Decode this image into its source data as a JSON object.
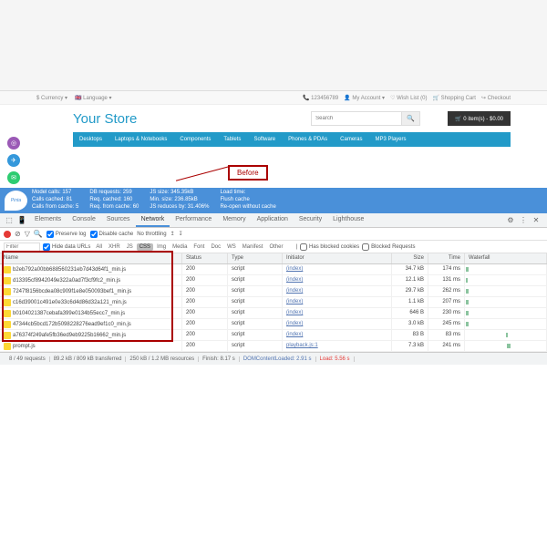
{
  "topbar": {
    "currency": "$ Currency ▾",
    "language": "🇬🇧 Language ▾",
    "phone": "📞 123456789",
    "account": "👤 My Account ▾",
    "wishlist": "♡ Wish List (0)",
    "cart": "🛒 Shopping Cart",
    "checkout": "↪ Checkout"
  },
  "store": {
    "logo": "Your Store",
    "search_placeholder": "Search",
    "cart_label": "🛒 0 item(s) - $0.00"
  },
  "nav": [
    "Desktops",
    "Laptops & Notebooks",
    "Components",
    "Tablets",
    "Software",
    "Phones & PDAs",
    "Cameras",
    "MP3 Players"
  ],
  "before_label": "Before",
  "pinta": {
    "logo": "Pinta",
    "col1": [
      "Model calls: 157",
      "Calls cached: 81",
      "Calls from cache: 5"
    ],
    "col2": [
      "DB requests: 259",
      "Req. cached: 160",
      "Req. from cache: 60"
    ],
    "col3": [
      "JS size: 345.35kB",
      "Min. size: 236.85kB",
      "JS reduces by: 31.406%"
    ],
    "col4": [
      "Load time:",
      "Flush cache",
      "Re-open without cache"
    ]
  },
  "devtools": {
    "tabs": [
      "Elements",
      "Console",
      "Sources",
      "Network",
      "Performance",
      "Memory",
      "Application",
      "Security",
      "Lighthouse"
    ],
    "active_tab": 3,
    "preserve": "Preserve log",
    "disable_cache": "Disable cache",
    "throttling": "No throttling",
    "hide_data": "Hide data URLs",
    "filter_chips": [
      "All",
      "XHR",
      "JS",
      "CSS",
      "Img",
      "Media",
      "Font",
      "Doc",
      "WS",
      "Manifest",
      "Other"
    ],
    "active_chip": 3,
    "blocked_cookies": "Has blocked cookies",
    "blocked_req": "Blocked Requests",
    "columns": [
      "Name",
      "Status",
      "Type",
      "Initiator",
      "Size",
      "Time",
      "Waterfall"
    ],
    "rows": [
      {
        "name": "b2eb792a00bb688560231eb7d43d64f1_min.js",
        "status": "200",
        "type": "script",
        "init": "(index)",
        "size": "34.7 kB",
        "time": "174 ms",
        "wf": [
          1,
          3
        ]
      },
      {
        "name": "d13395cf8942049e322a0ad7f3cf9fc2_min.js",
        "status": "200",
        "type": "script",
        "init": "(index)",
        "size": "12.1 kB",
        "time": "131 ms",
        "wf": [
          1,
          2
        ]
      },
      {
        "name": "7247f8156bcdea08c909f1e8e050093bef1_min.js",
        "status": "200",
        "type": "script",
        "init": "(index)",
        "size": "29.7 kB",
        "time": "262 ms",
        "wf": [
          1,
          4
        ]
      },
      {
        "name": "c16d39001c491e0e33c6d4d86d32a121_min.js",
        "status": "200",
        "type": "script",
        "init": "(index)",
        "size": "1.1 kB",
        "time": "207 ms",
        "wf": [
          1,
          3
        ]
      },
      {
        "name": "b0104021387cebafa399e0134b55ecc7_min.js",
        "status": "200",
        "type": "script",
        "init": "(index)",
        "size": "646 B",
        "time": "230 ms",
        "wf": [
          1,
          3
        ]
      },
      {
        "name": "47344cb5bcd172b5098228276ead9ef1c0_min.js",
        "status": "200",
        "type": "script",
        "init": "(index)",
        "size": "3.0 kB",
        "time": "245 ms",
        "wf": [
          1,
          4
        ]
      },
      {
        "name": "a76374f249afe5fb36ed9eb9225b16662_min.js",
        "status": "200",
        "type": "script",
        "init": "(index)",
        "size": "83 B",
        "time": "83 ms",
        "wf": [
          51,
          2
        ]
      },
      {
        "name": "prompt.js",
        "status": "200",
        "type": "script",
        "init": "playback.js:1",
        "size": "7.3 kB",
        "time": "241 ms",
        "wf": [
          52,
          4
        ]
      }
    ],
    "footer": {
      "requests": "8 / 49 requests",
      "transferred": "89.2 kB / 809 kB transferred",
      "resources": "250 kB / 1.2 MB resources",
      "finish": "Finish: 8.17 s",
      "dcl": "DOMContentLoaded: 2.91 s",
      "load": "Load: 5.56 s"
    }
  }
}
